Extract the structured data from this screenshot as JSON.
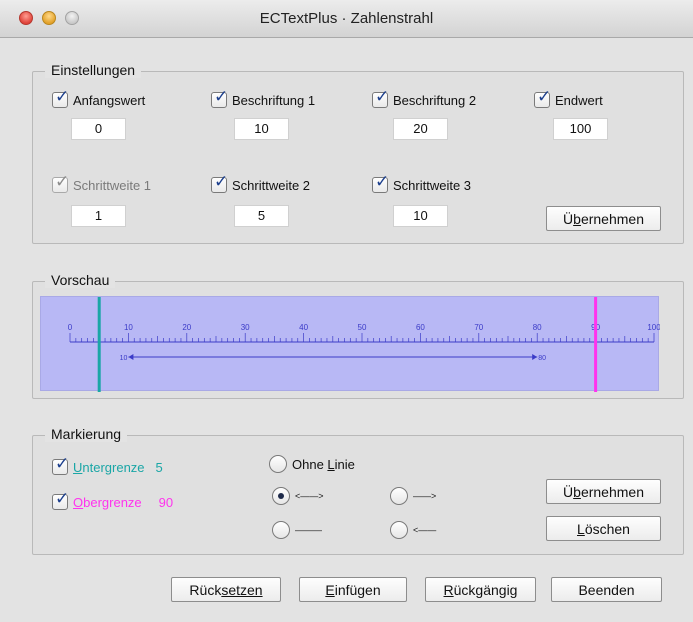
{
  "window": {
    "title": "ECTextPlus · Zahlenstrahl"
  },
  "settings": {
    "title": "Einstellungen",
    "items": [
      {
        "label": "Anfangswert",
        "checked": true,
        "enabled": true,
        "value": "0"
      },
      {
        "label": "Beschriftung 1",
        "checked": true,
        "enabled": true,
        "value": "10"
      },
      {
        "label": "Beschriftung 2",
        "checked": true,
        "enabled": true,
        "value": "20"
      },
      {
        "label": "Endwert",
        "checked": true,
        "enabled": true,
        "value": "100"
      },
      {
        "label": "Schrittweite 1",
        "checked": true,
        "enabled": false,
        "value": "1"
      },
      {
        "label": "Schrittweite 2",
        "checked": true,
        "enabled": true,
        "value": "5"
      },
      {
        "label": "Schrittweite 3",
        "checked": true,
        "enabled": true,
        "value": "10"
      }
    ],
    "apply_pre": "Ü",
    "apply_mnemonic": "b",
    "apply_post": "ernehmen"
  },
  "preview": {
    "title": "Vorschau",
    "axis_min": 0,
    "axis_max": 100,
    "labels": [
      "0",
      "10",
      "20",
      "30",
      "40",
      "50",
      "60",
      "70",
      "80",
      "90",
      "100"
    ],
    "range_start_label": "10",
    "range_end_label": "80",
    "range_start": 10,
    "range_end": 80,
    "lower_marker": 5,
    "upper_marker": 90,
    "colors": {
      "background": "#b8b8f5",
      "axis": "#3b3bc8",
      "lower": "#1aa6a6",
      "upper": "#ff33ee"
    }
  },
  "marking": {
    "title": "Markierung",
    "lower": {
      "label": "Untergrenze",
      "mnemonic": "U",
      "rest": "ntergrenze",
      "value": "5",
      "color": "#1aa6a6"
    },
    "upper": {
      "label": "Obergrenze",
      "mnemonic": "O",
      "rest": "bergrenze",
      "value": "90",
      "color": "#ff33ee"
    },
    "radio_no_line_pre": "Ohne ",
    "radio_no_line_mnemonic": "L",
    "radio_no_line_post": "inie",
    "radio_both": "<——>",
    "radio_right": "——>",
    "radio_plain": "———",
    "radio_left": "<——",
    "apply_pre": "Ü",
    "apply_mnemonic": "b",
    "apply_post": "ernehmen",
    "delete_mnemonic": "L",
    "delete_rest": "öschen"
  },
  "footer": {
    "reset_pre": "Rück",
    "reset_mnemonic": "setzen",
    "insert_mnemonic": "E",
    "insert_rest": "infügen",
    "undo_mnemonic": "R",
    "undo_rest": "ückgängig",
    "quit": "Beenden"
  }
}
